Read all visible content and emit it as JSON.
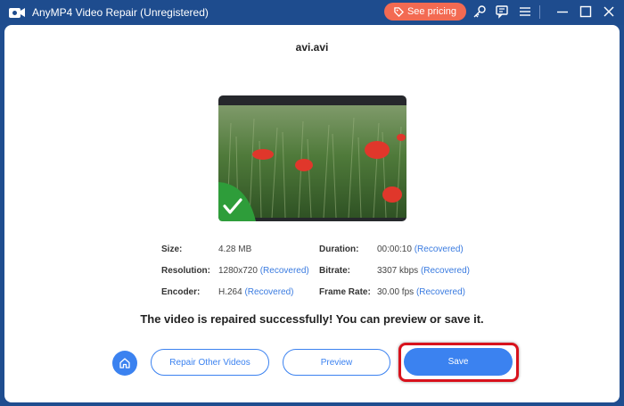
{
  "window": {
    "title": "AnyMP4 Video Repair (Unregistered)",
    "pricing_label": "See pricing"
  },
  "file": {
    "name": "avi.avi"
  },
  "info": {
    "size_label": "Size:",
    "size_value": "4.28 MB",
    "duration_label": "Duration:",
    "duration_value": "00:00:10",
    "resolution_label": "Resolution:",
    "resolution_value": "1280x720",
    "bitrate_label": "Bitrate:",
    "bitrate_value": "3307 kbps",
    "encoder_label": "Encoder:",
    "encoder_value": "H.264",
    "framerate_label": "Frame Rate:",
    "framerate_value": "30.00 fps",
    "recovered_tag": "(Recovered)"
  },
  "message": "The video is repaired successfully! You can preview or save it.",
  "buttons": {
    "repair_other": "Repair Other Videos",
    "preview": "Preview",
    "save": "Save"
  },
  "colors": {
    "titlebar": "#1e4c8e",
    "accent": "#3b82f0",
    "pricing": "#f36a52",
    "highlight": "#d8121c",
    "success_badge": "#2e9d3a"
  },
  "icons": [
    "app-logo-icon",
    "tag-icon",
    "key-icon",
    "chat-icon",
    "menu-icon",
    "minimize-icon",
    "maximize-icon",
    "close-icon",
    "checkmark-icon",
    "home-icon"
  ]
}
